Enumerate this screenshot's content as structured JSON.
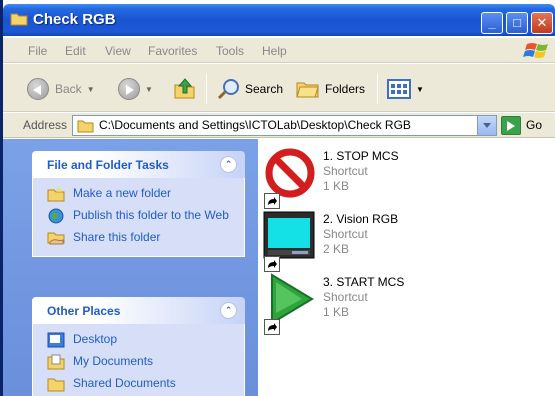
{
  "window": {
    "title": "Check RGB"
  },
  "menu": [
    "File",
    "Edit",
    "View",
    "Favorites",
    "Tools",
    "Help"
  ],
  "toolbar": {
    "back_label": "Back",
    "search_label": "Search",
    "folders_label": "Folders"
  },
  "address": {
    "label": "Address",
    "value": "C:\\Documents and Settings\\ICTOLab\\Desktop\\Check RGB",
    "go_label": "Go"
  },
  "tasks_panel": {
    "title": "File and Folder Tasks",
    "items": [
      {
        "label": "Make a new folder",
        "icon": "new-folder-icon"
      },
      {
        "label": "Publish this folder to the Web",
        "icon": "publish-web-icon"
      },
      {
        "label": "Share this folder",
        "icon": "share-folder-icon"
      }
    ]
  },
  "places_panel": {
    "title": "Other Places",
    "items": [
      {
        "label": "Desktop",
        "icon": "desktop-icon"
      },
      {
        "label": "My Documents",
        "icon": "my-documents-icon"
      },
      {
        "label": "Shared Documents",
        "icon": "shared-documents-icon"
      }
    ]
  },
  "files": [
    {
      "name": "1. STOP MCS",
      "type": "Shortcut",
      "size": "1 KB",
      "icon": "stop-icon"
    },
    {
      "name": "2. Vision RGB",
      "type": "Shortcut",
      "size": "2 KB",
      "icon": "vision-monitor-icon"
    },
    {
      "name": "3. START MCS",
      "type": "Shortcut",
      "size": "1 KB",
      "icon": "start-play-icon"
    }
  ],
  "colors": {
    "title_bar": "#1a53d0",
    "task_pane": "#7ba1e8",
    "link": "#215dc6"
  }
}
